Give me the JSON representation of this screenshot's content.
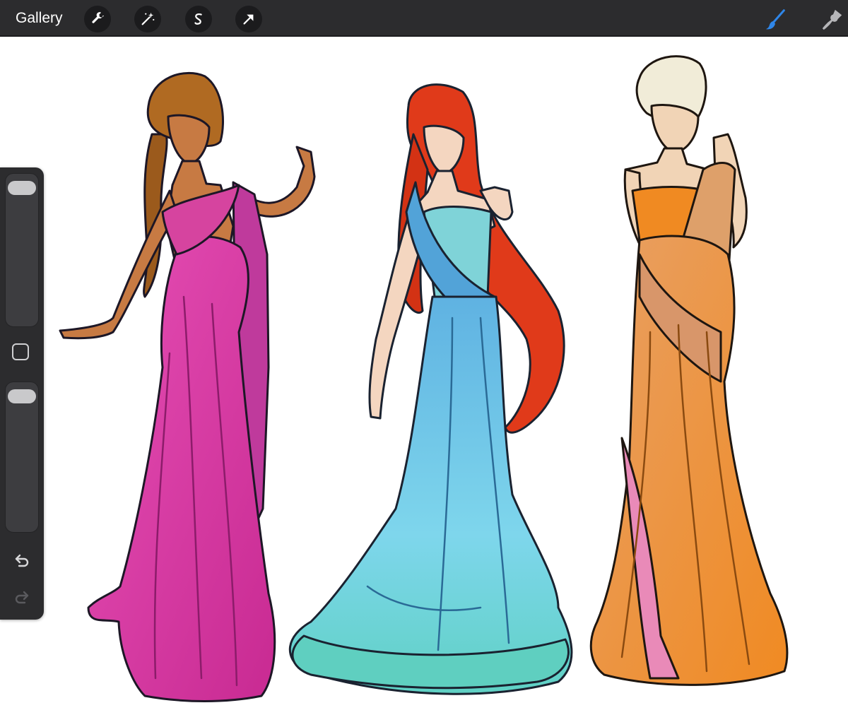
{
  "toolbar": {
    "gallery_label": "Gallery",
    "left_tools": [
      "wrench-icon",
      "magic-wand-icon",
      "selection-icon",
      "transform-arrow-icon"
    ],
    "right_tools": [
      "brush-icon",
      "smudge-icon"
    ],
    "active_tool": "brush-icon",
    "colors": {
      "bar": "#2c2c2e",
      "button": "#1b1b1d",
      "icon": "#ffffff",
      "active": "#2f86e8"
    }
  },
  "sidebar": {
    "sliders": [
      "brush-size-slider",
      "opacity-slider"
    ],
    "buttons": [
      "modify-button",
      "undo-icon",
      "redo-icon"
    ]
  },
  "canvas": {
    "figures": [
      {
        "dress_color": "#d43aa4",
        "hair_color": "#a8621e"
      },
      {
        "dress_color": "#58b5e0",
        "hair_color": "#e03a1a"
      },
      {
        "dress_color": "#f0902c",
        "hair_color": "#f1ecd8"
      }
    ]
  }
}
